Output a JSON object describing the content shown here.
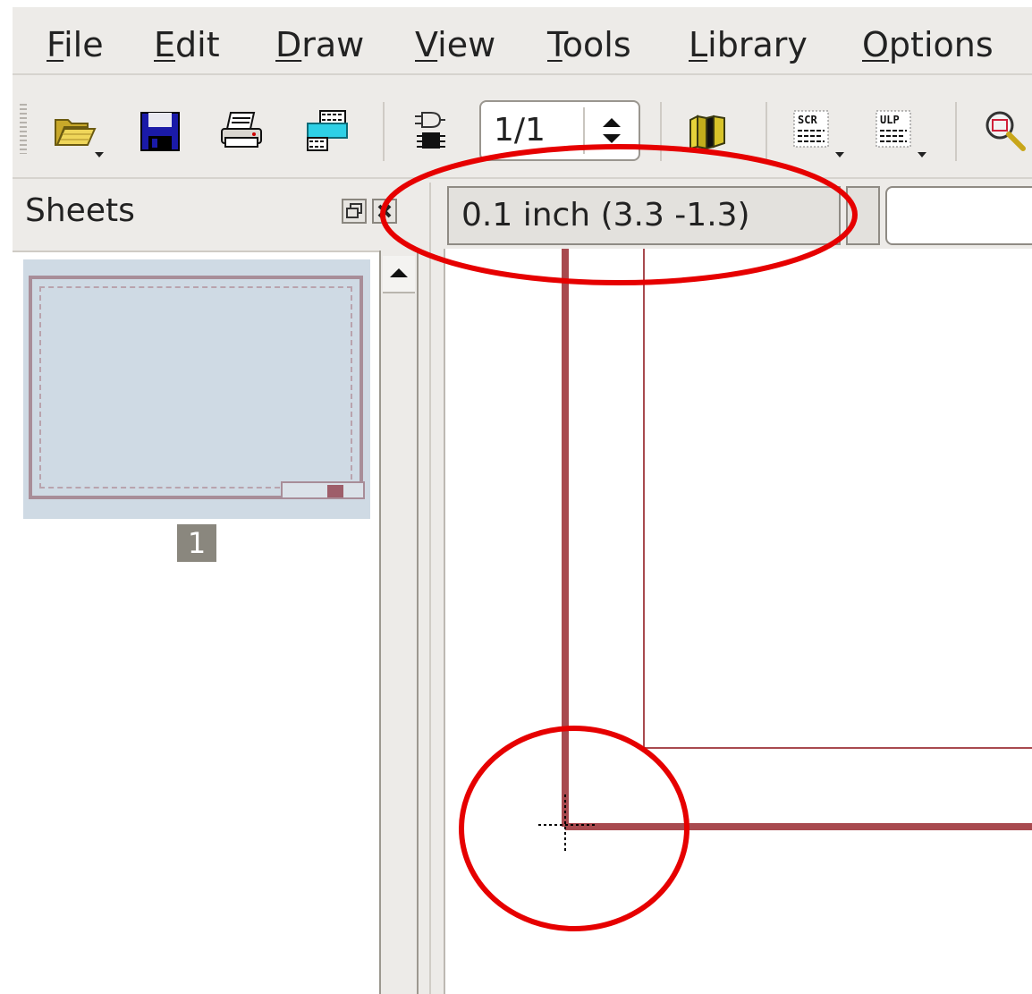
{
  "menu": {
    "items": [
      {
        "mnemonic": "F",
        "rest": "ile"
      },
      {
        "mnemonic": "E",
        "rest": "dit"
      },
      {
        "mnemonic": "D",
        "rest": "raw"
      },
      {
        "mnemonic": "V",
        "rest": "iew"
      },
      {
        "mnemonic": "T",
        "rest": "ools"
      },
      {
        "mnemonic": "L",
        "rest": "ibrary"
      },
      {
        "mnemonic": "O",
        "rest": "ptions"
      }
    ]
  },
  "toolbar": {
    "sheet_spin_value": "1/1",
    "scr_label": "SCR",
    "ulp_label": "ULP"
  },
  "dock": {
    "title": "Sheets",
    "sheets": [
      {
        "number": "1"
      }
    ]
  },
  "status": {
    "coordinate": "0.1 inch (3.3 -1.3)",
    "command_input": ""
  },
  "colors": {
    "frame": "#a84a4f",
    "annotation": "#e60000",
    "thumb_bg": "#cfdae4"
  }
}
